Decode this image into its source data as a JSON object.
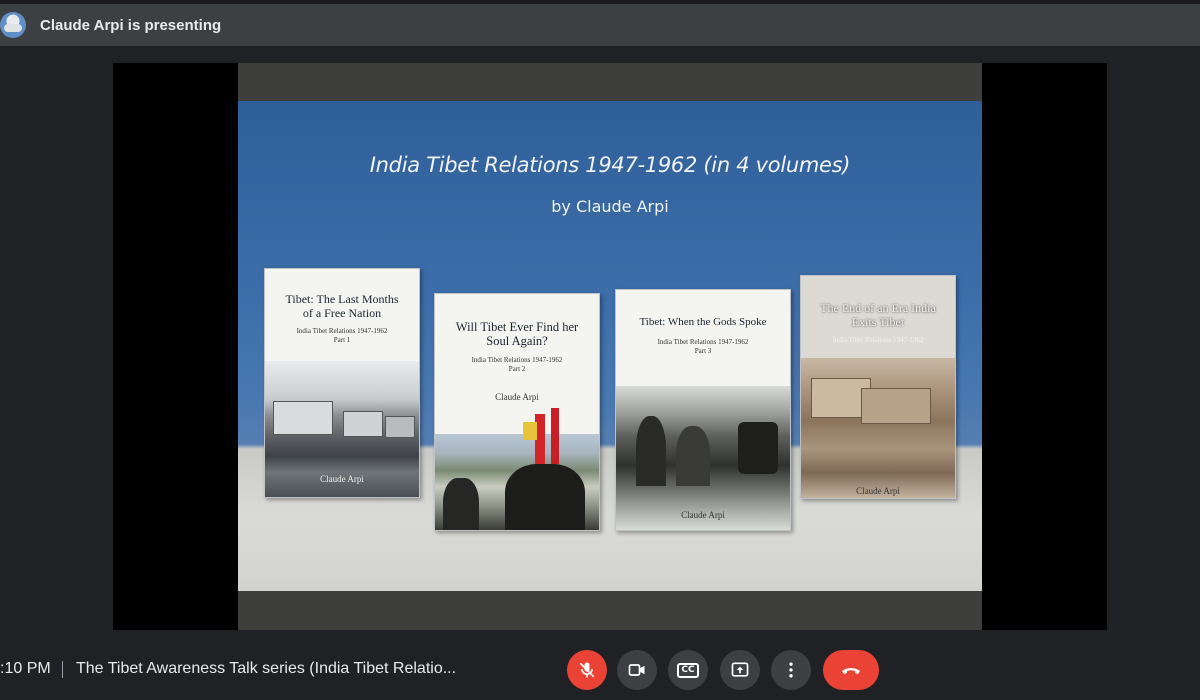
{
  "presenting": {
    "text": "Claude Arpi is presenting",
    "avatar_icon": "presenter-avatar-icon"
  },
  "slide": {
    "title": "India Tibet Relations  1947-1962 (in 4 volumes)",
    "subtitle": "by Claude Arpi",
    "books": [
      {
        "title": "Tibet: The Last Months of a Free Nation",
        "series": "India Tibet Relations 1947-1962",
        "part": "Part 1",
        "author": "Claude Arpi"
      },
      {
        "title": "Will Tibet Ever Find her Soul Again?",
        "series": "India Tibet Relations 1947-1962",
        "part": "Part 2",
        "author": "Claude Arpi"
      },
      {
        "title": "Tibet: When the Gods Spoke",
        "series": "India Tibet Relations 1947-1962",
        "part": "Part 3",
        "author": "Claude Arpi"
      },
      {
        "title": "The End of an Era India Exits Tibet",
        "series": "India Tibet Relations 1947-1962",
        "part": "",
        "author": "Claude Arpi"
      }
    ]
  },
  "bottom_bar": {
    "time": ":10 PM",
    "meeting_title": "The Tibet Awareness Talk series (India Tibet Relatio...",
    "controls": [
      {
        "name": "microphone-off",
        "icon": "mic-off-icon",
        "color": "#ea4335"
      },
      {
        "name": "camera",
        "icon": "camera-icon",
        "color": "#3c4043"
      },
      {
        "name": "captions",
        "icon": "captions-icon",
        "label": "CC",
        "color": "#3c4043"
      },
      {
        "name": "present-now",
        "icon": "present-icon",
        "color": "#3c4043"
      },
      {
        "name": "more-options",
        "icon": "more-vert-icon",
        "color": "#3c4043"
      },
      {
        "name": "leave-call",
        "icon": "hangup-icon",
        "color": "#ea4335"
      }
    ]
  }
}
